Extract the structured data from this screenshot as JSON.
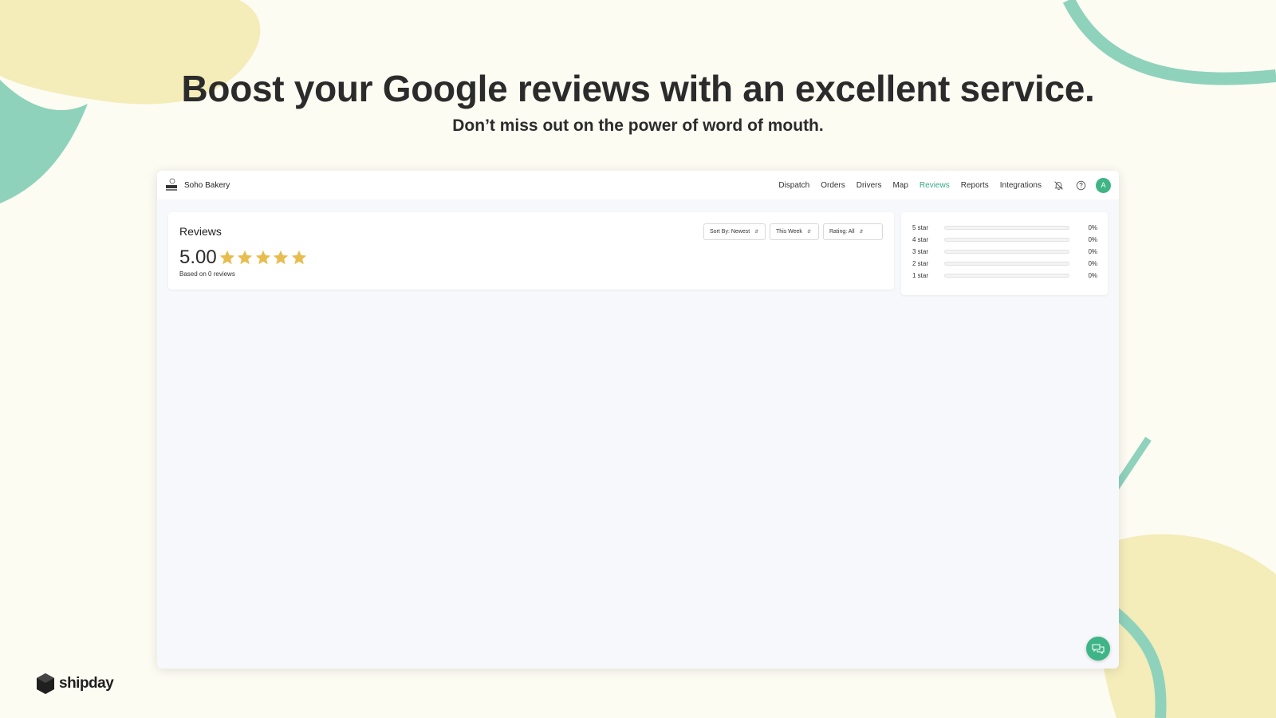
{
  "hero": {
    "title": "Boost your Google reviews with an excellent service.",
    "subtitle": "Don’t miss out on the power of word of mouth."
  },
  "app": {
    "brand": {
      "name": "Soho Bakery",
      "logo_text": "SOHO BAKERY"
    },
    "nav": [
      {
        "label": "Dispatch",
        "active": false
      },
      {
        "label": "Orders",
        "active": false
      },
      {
        "label": "Drivers",
        "active": false
      },
      {
        "label": "Map",
        "active": false
      },
      {
        "label": "Reviews",
        "active": true
      },
      {
        "label": "Reports",
        "active": false
      },
      {
        "label": "Integrations",
        "active": false
      }
    ],
    "icons": [
      "bell-off-icon",
      "help-icon"
    ],
    "avatar_initial": "A",
    "accent_color": "#3aa98a",
    "reviews": {
      "title": "Reviews",
      "average": "5.00",
      "stars": 5,
      "star_color": "#e8bd4f",
      "based_on": "Based on 0 reviews",
      "filters": [
        {
          "label": "Sort By: Newest"
        },
        {
          "label": "This Week"
        },
        {
          "label": "Rating: All"
        }
      ]
    },
    "distribution": [
      {
        "label": "5 star",
        "percent_text": "0%",
        "fraction": 0
      },
      {
        "label": "4 star",
        "percent_text": "0%",
        "fraction": 0
      },
      {
        "label": "3 star",
        "percent_text": "0%",
        "fraction": 0
      },
      {
        "label": "2 star",
        "percent_text": "0%",
        "fraction": 0
      },
      {
        "label": "1 star",
        "percent_text": "0%",
        "fraction": 0
      }
    ]
  },
  "footer": {
    "logo_text": "shipday"
  },
  "colors": {
    "background": "#fdfcf3",
    "blob_yellow": "#f4ecb9",
    "blob_teal": "#8fd2bc"
  }
}
